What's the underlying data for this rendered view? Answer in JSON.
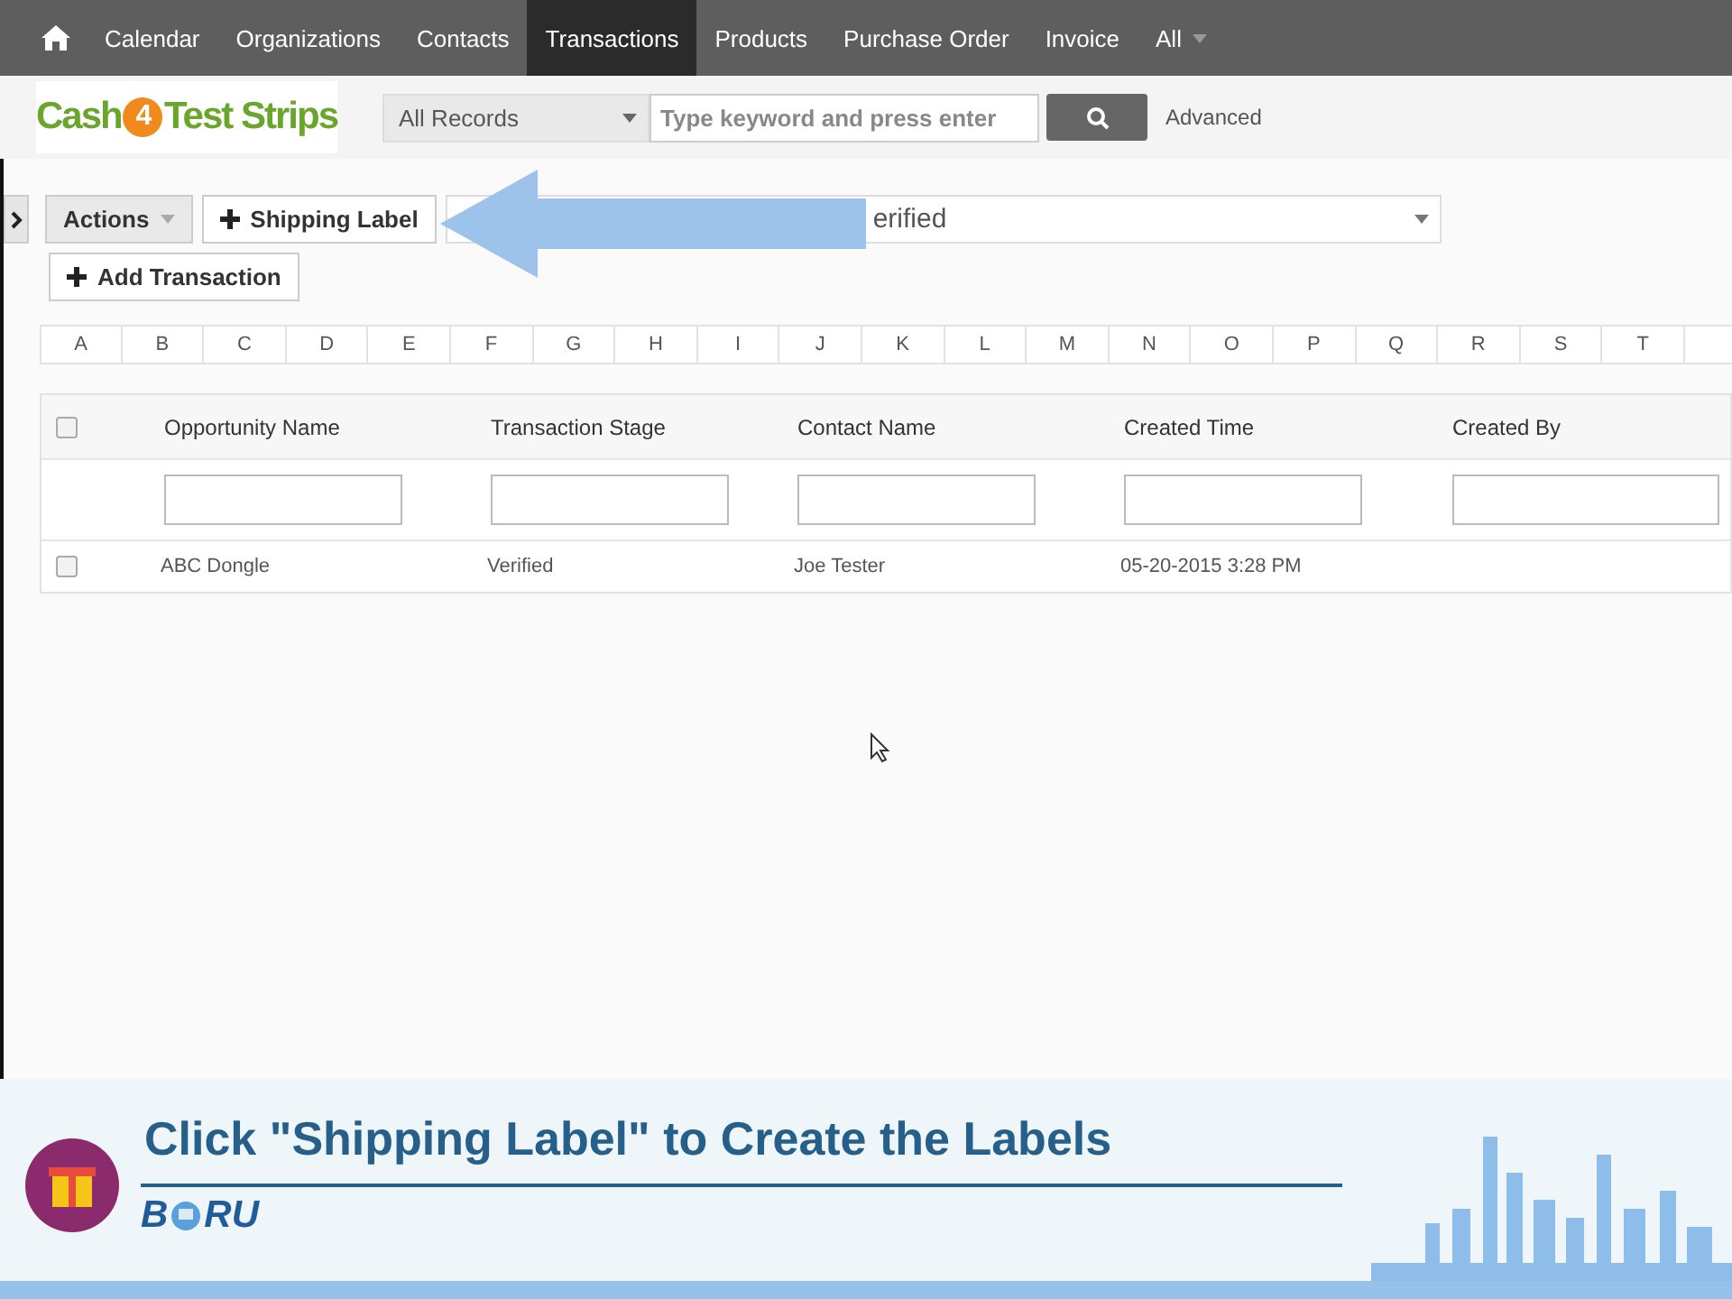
{
  "nav": {
    "items": [
      {
        "label": "Calendar",
        "selected": false
      },
      {
        "label": "Organizations",
        "selected": false
      },
      {
        "label": "Contacts",
        "selected": false
      },
      {
        "label": "Transactions",
        "selected": true
      },
      {
        "label": "Products",
        "selected": false
      },
      {
        "label": "Purchase Order",
        "selected": false
      },
      {
        "label": "Invoice",
        "selected": false
      },
      {
        "label": "All",
        "selected": false
      }
    ]
  },
  "logo": {
    "part_1": "Cash",
    "part_2": "4",
    "part_3": "Test Strips"
  },
  "search": {
    "scope": "All Records",
    "placeholder": "Type keyword and press enter",
    "advanced": "Advanced"
  },
  "toolbar": {
    "actions": "Actions",
    "shipping_label": "Shipping Label",
    "add_transaction": "Add Transaction",
    "filter_value": "erified"
  },
  "alphabet": [
    "A",
    "B",
    "C",
    "D",
    "E",
    "F",
    "G",
    "H",
    "I",
    "J",
    "K",
    "L",
    "M",
    "N",
    "O",
    "P",
    "Q",
    "R",
    "S",
    "T"
  ],
  "table": {
    "all_checked": false,
    "columns": [
      "Opportunity Name",
      "Transaction Stage",
      "Contact Name",
      "Created Time",
      "Created By"
    ],
    "rows": [
      {
        "checked": false,
        "cells": [
          "ABC Dongle",
          "Verified",
          "Joe Tester",
          "05-20-2015 3:28 PM",
          ""
        ]
      }
    ]
  },
  "banner": {
    "title": "Click \"Shipping Label\" to Create the Labels",
    "brand_start": "B",
    "brand_end": "RU"
  }
}
